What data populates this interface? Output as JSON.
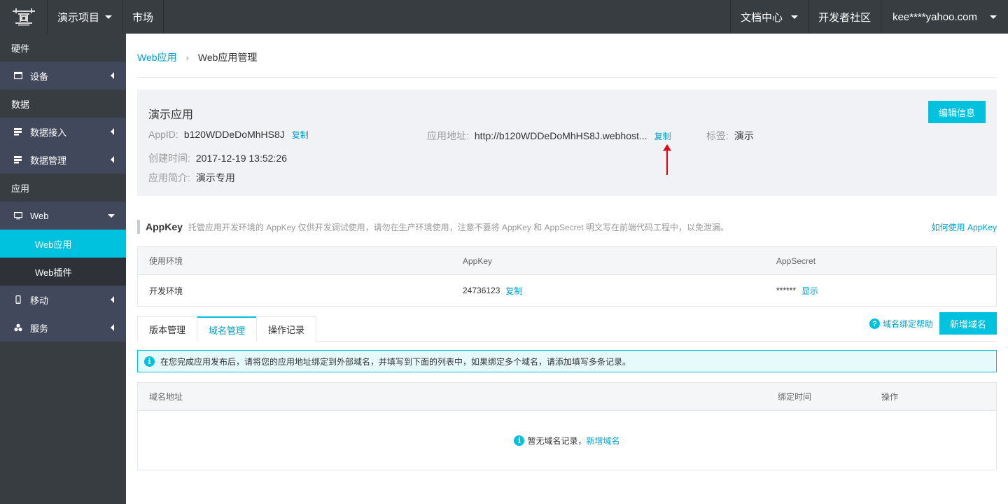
{
  "topbar": {
    "project_label": "演示项目",
    "market_label": "市场",
    "docs_label": "文档中心",
    "community_label": "开发者社区",
    "user_label": "kee****yahoo.com"
  },
  "sidebar": {
    "group_hardware": "硬件",
    "item_device": "设备",
    "group_data": "数据",
    "item_data_access": "数据接入",
    "item_data_manage": "数据管理",
    "group_app": "应用",
    "item_web": "Web",
    "sub_web_app": "Web应用",
    "sub_web_plugin": "Web插件",
    "item_mobile": "移动",
    "item_service": "服务"
  },
  "breadcrumb": {
    "parent": "Web应用",
    "current": "Web应用管理"
  },
  "app_info": {
    "name": "演示应用",
    "edit_label": "编辑信息",
    "appid_label": "AppID:",
    "appid_value": "b120WDDeDoMhHS8J",
    "copy_label": "复制",
    "url_label": "应用地址:",
    "url_value": "http://b120WDDeDoMhHS8J.webhost...",
    "tag_label": "标签:",
    "tag_value": "演示",
    "created_label": "创建时间:",
    "created_value": "2017-12-19 13:52:26",
    "intro_label": "应用简介:",
    "intro_value": "演示专用"
  },
  "appkey_section": {
    "title": "AppKey",
    "desc": "托管应用开发环境的 AppKey 仅供开发调试使用，请勿在生产环境使用，注意不要将 AppKey 和 AppSecret 明文写在前端代码工程中，以免泄漏。",
    "help_link": "如何使用 AppKey",
    "columns": [
      "使用环境",
      "AppKey",
      "AppSecret"
    ],
    "row": {
      "env": "开发环境",
      "appkey": "24736123",
      "copy": "复制",
      "secret": "******",
      "show": "显示"
    }
  },
  "tabs": [
    "版本管理",
    "域名管理",
    "操作记录"
  ],
  "domain": {
    "help_label": "域名绑定帮助",
    "add_label": "新增域名",
    "notice": "在您完成应用发布后，请将您的应用地址绑定到外部域名，并填写到下面的列表中，如果绑定多个域名，请添加填写多条记录。",
    "columns": [
      "域名地址",
      "绑定时间",
      "操作"
    ],
    "empty_text": "暂无域名记录，",
    "empty_link": "新增域名"
  },
  "colors": {
    "accent": "#00c1de",
    "link": "#00a2ca",
    "topbar": "#373d41",
    "sidebar": "#42485b",
    "arrow": "#e60012"
  }
}
